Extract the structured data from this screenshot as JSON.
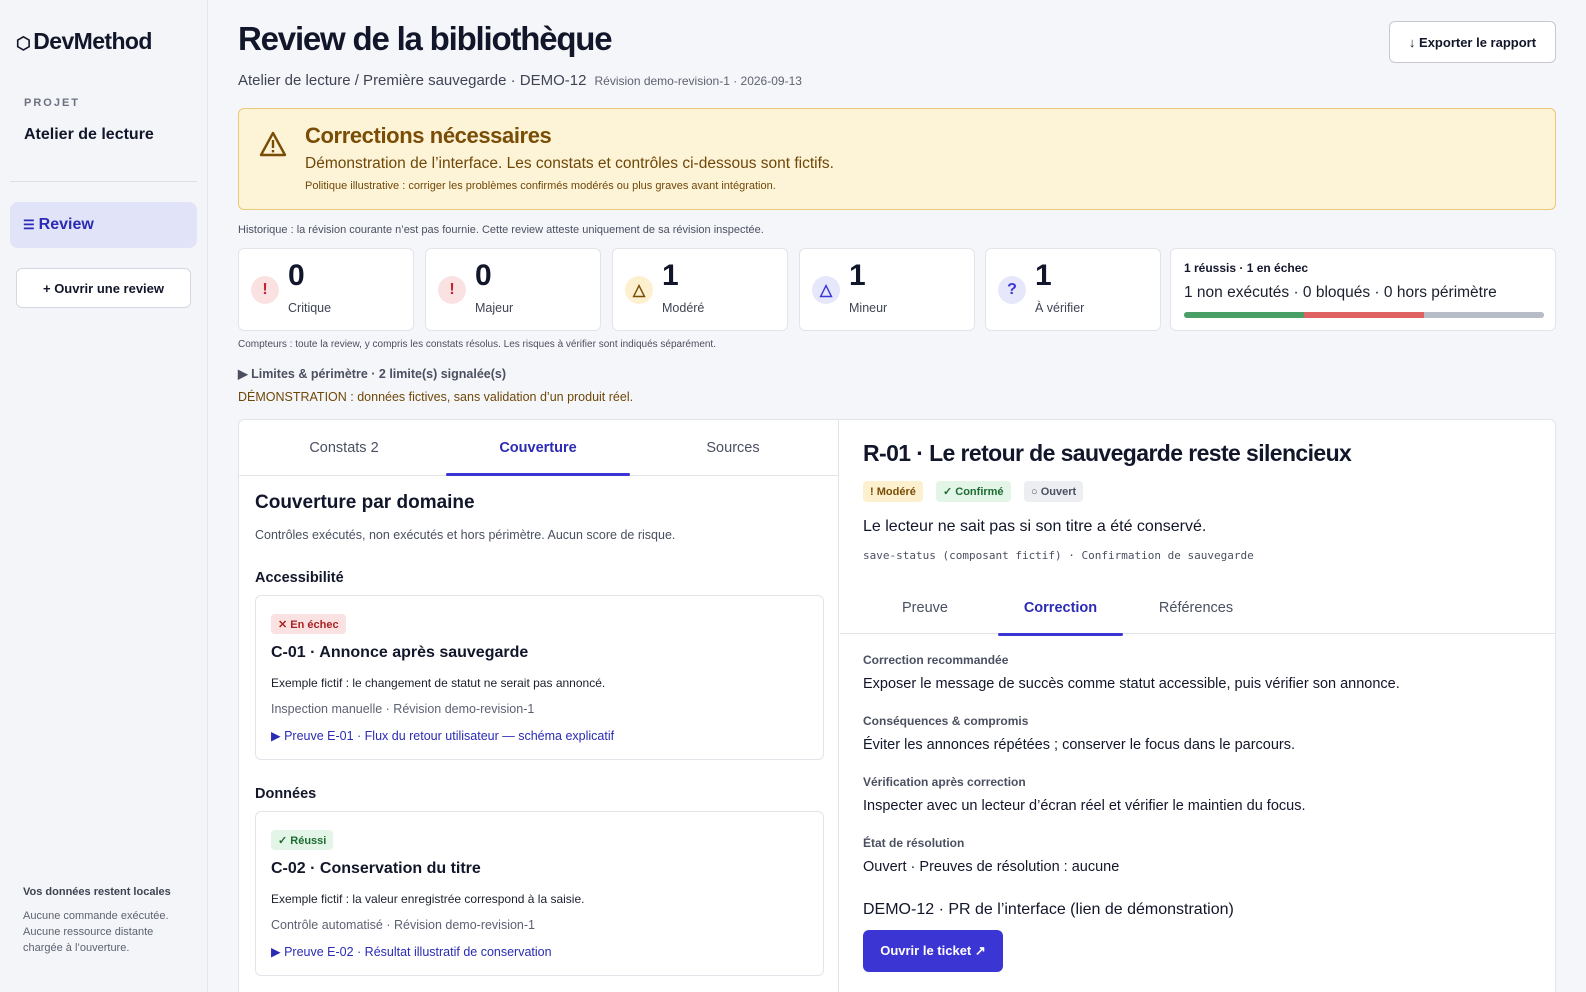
{
  "sidebar": {
    "logo_text": "DevMethod",
    "project_label": "PROJET",
    "project_name": "Atelier de lecture",
    "nav_review": "Review",
    "open_review_button": "+ Ouvrir une review",
    "footer_title": "Vos données restent locales",
    "footer_text": "Aucune commande exécutée. Aucune ressource distante chargée à l’ouverture."
  },
  "header": {
    "title": "Review de la bibliothèque",
    "export_button": "↓ Exporter le rapport",
    "breadcrumb": "Atelier de lecture / Première sauvegarde · DEMO-12",
    "revision": "Révision demo-revision-1 · 2026-09-13"
  },
  "alert": {
    "title": "Corrections nécessaires",
    "text": "Démonstration de l’interface. Les constats et contrôles ci-dessous sont fictifs.",
    "policy": "Politique illustrative : corriger les problèmes confirmés modérés ou plus graves avant intégration."
  },
  "history_note": "Historique : la révision courante n’est pas fournie. Cette review atteste uniquement de sa révision inspectée.",
  "stats": [
    {
      "count": "0",
      "label": "Critique",
      "icon": "!",
      "icon_name": "critical-icon",
      "color": "#c0262b",
      "bg": "#fbe2e2"
    },
    {
      "count": "0",
      "label": "Majeur",
      "icon": "!",
      "icon_name": "major-icon",
      "color": "#c0262b",
      "bg": "#fbe2e2"
    },
    {
      "count": "1",
      "label": "Modéré",
      "icon": "△",
      "icon_name": "moderate-icon",
      "color": "#7a4d06",
      "bg": "#fdf0cf"
    },
    {
      "count": "1",
      "label": "Mineur",
      "icon": "△",
      "icon_name": "minor-icon",
      "color": "#3b35d4",
      "bg": "#e6e7fb"
    },
    {
      "count": "1",
      "label": "À vérifier",
      "icon": "?",
      "icon_name": "to-verify-icon",
      "color": "#3b35d4",
      "bg": "#e6e7fb"
    }
  ],
  "summary": {
    "line1": "1 réussis · 1 en échec",
    "line2": "1 non exécutés · 0 bloqués · 0 hors périmètre",
    "bar": [
      {
        "name": "réussis",
        "value": 1,
        "color": "#4a9f67"
      },
      {
        "name": "en échec",
        "value": 1,
        "color": "#e06161"
      },
      {
        "name": "non exécutés",
        "value": 1,
        "color": "#b7bcc9"
      }
    ]
  },
  "counters_note": "Compteurs : toute la review, y compris les constats résolus. Les risques à vérifier sont indiqués séparément.",
  "limits_toggle": "▶ Limites & périmètre · 2 limite(s) signalée(s)",
  "demo_note": "DÉMONSTRATION : données fictives, sans validation d’un produit réel.",
  "left_tabs": [
    "Constats 2",
    "Couverture",
    "Sources"
  ],
  "coverage": {
    "title": "Couverture par domaine",
    "subtitle": "Contrôles exécutés, non exécutés et hors périmètre. Aucun score de risque.",
    "domains": [
      {
        "name": "Accessibilité",
        "status": "✕ En échec",
        "title": "C-01 · Annonce après sauvegarde",
        "desc": "Exemple fictif : le changement de statut ne serait pas annoncé.",
        "meta": "Inspection manuelle · Révision demo-revision-1",
        "evidence": "▶ Preuve E-01 · Flux du retour utilisateur — schéma explicatif"
      },
      {
        "name": "Données",
        "status": "✓ Réussi",
        "title": "C-02 · Conservation du titre",
        "desc": "Exemple fictif : la valeur enregistrée correspond à la saisie.",
        "meta": "Contrôle automatisé · Révision demo-revision-1",
        "evidence": "▶ Preuve E-02 · Résultat illustratif de conservation"
      }
    ]
  },
  "finding": {
    "title": "R-01 · Le retour de sauvegarde reste silencieux",
    "severity": "! Modéré",
    "confirmation": "✓ Confirmé",
    "status": "○ Ouvert",
    "description": "Le lecteur ne sait pas si son titre a été conservé.",
    "code": "save-status (composant fictif) · Confirmation de sauvegarde",
    "tabs": [
      "Preuve",
      "Correction",
      "Références"
    ],
    "sections": [
      {
        "heading": "Correction recommandée",
        "value": "Exposer le message de succès comme statut accessible, puis vérifier son annonce."
      },
      {
        "heading": "Conséquences & compromis",
        "value": "Éviter les annonces répétées ; conserver le focus dans le parcours."
      },
      {
        "heading": "Vérification après correction",
        "value": "Inspecter avec un lecteur d’écran réel et vérifier le maintien du focus."
      },
      {
        "heading": "État de résolution",
        "value": "Ouvert · Preuves de résolution : aucune"
      }
    ],
    "ticket": "DEMO-12 · PR de l’interface (lien de démonstration)",
    "ticket_button": "Ouvrir le ticket ↗"
  }
}
